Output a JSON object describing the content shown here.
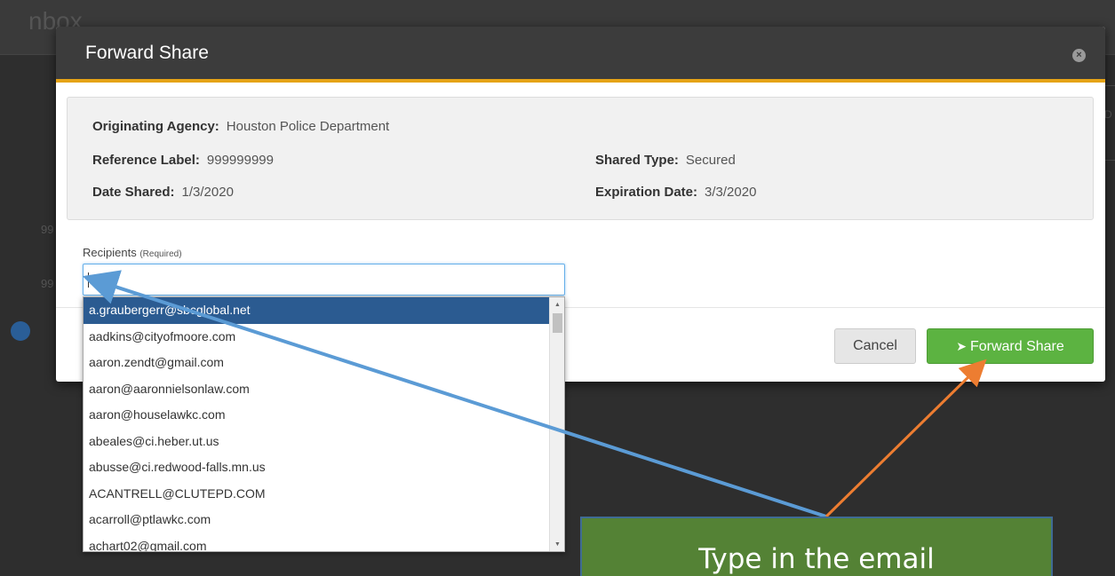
{
  "background": {
    "title": "nbox",
    "row_prefix_1": "99",
    "row_prefix_2": "99",
    "right_edge_text": "D"
  },
  "modal": {
    "title": "Forward Share",
    "close_label": "×",
    "info": {
      "originating_agency_label": "Originating Agency:",
      "originating_agency_value": "Houston Police Department",
      "reference_label_label": "Reference Label:",
      "reference_label_value": "999999999",
      "date_shared_label": "Date Shared:",
      "date_shared_value": "1/3/2020",
      "shared_type_label": "Shared Type:",
      "shared_type_value": "Secured",
      "expiration_date_label": "Expiration Date:",
      "expiration_date_value": "3/3/2020"
    },
    "recipients": {
      "label": "Recipients",
      "required_note": "(Required)",
      "value": ""
    },
    "buttons": {
      "cancel": "Cancel",
      "forward": "Forward Share"
    }
  },
  "dropdown": {
    "items": [
      "a.graubergerr@sbcglobal.net",
      "aadkins@cityofmoore.com",
      "aaron.zendt@gmail.com",
      "aaron@aaronnielsonlaw.com",
      "aaron@houselawkc.com",
      "abeales@ci.heber.ut.us",
      "abusse@ci.redwood-falls.mn.us",
      "ACANTRELL@CLUTEPD.COM",
      "acarroll@ptlawkc.com",
      "achart02@gmail.com"
    ],
    "selected_index": 0
  },
  "annotation": {
    "text": "Type in the email",
    "colors": {
      "box": "#548235",
      "blue_arrow": "#5b9bd5",
      "orange_arrow": "#ed7d31"
    }
  }
}
